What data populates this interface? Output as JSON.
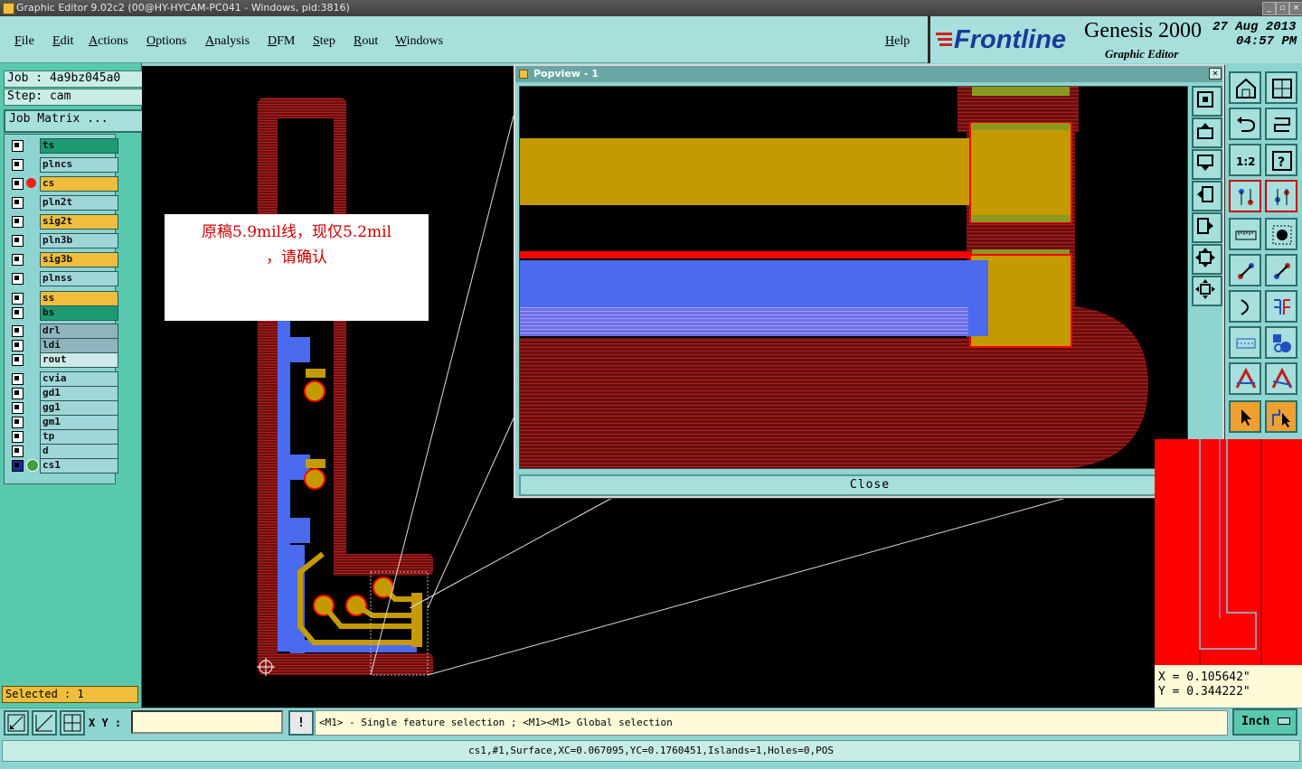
{
  "window": {
    "title": "Graphic Editor 9.02c2 (00@HY-HYCAM-PC041 - Windows, pid:3816)"
  },
  "menu": {
    "items": [
      "File",
      "Edit",
      "Actions",
      "Options",
      "Analysis",
      "DFM",
      "Step",
      "Rout",
      "Windows"
    ],
    "help": "Help"
  },
  "brand": {
    "logo": "Frontline",
    "product": "Genesis 2000",
    "subtitle": "Graphic Editor",
    "date": "27 Aug 2013",
    "time": "04:57 PM"
  },
  "job": {
    "job_label": "Job : 4a9bz045a0",
    "step_label": "Step: cam",
    "matrix_button": "Job Matrix ..."
  },
  "layers": [
    {
      "name": "ts",
      "color": "#1d9a72"
    },
    {
      "name": "plncs",
      "color": "#9fd6d8"
    },
    {
      "name": "cs",
      "color": "#f0be3c"
    },
    {
      "name": "pln2t",
      "color": "#9fd6d8"
    },
    {
      "name": "sig2t",
      "color": "#f0be3c"
    },
    {
      "name": "pln3b",
      "color": "#9fd6d8"
    },
    {
      "name": "sig3b",
      "color": "#f0be3c"
    },
    {
      "name": "plnss",
      "color": "#9fd6d8"
    },
    {
      "name": "ss",
      "color": "#f0be3c"
    },
    {
      "name": "bs",
      "color": "#1d9a72"
    },
    {
      "name": "drl",
      "color": "#8fb4bc"
    },
    {
      "name": "ldi",
      "color": "#8fb4bc"
    },
    {
      "name": "rout",
      "color": "#cfe8e8"
    },
    {
      "name": "cvia",
      "color": "#9fd6d8"
    },
    {
      "name": "gd1",
      "color": "#9fd6d8"
    },
    {
      "name": "gg1",
      "color": "#9fd6d8"
    },
    {
      "name": "gm1",
      "color": "#9fd6d8"
    },
    {
      "name": "tp",
      "color": "#9fd6d8"
    },
    {
      "name": "d",
      "color": "#9fd6d8"
    },
    {
      "name": "cs1",
      "color": "#9fd6d8"
    }
  ],
  "selected": "Selected : 1",
  "annotation": {
    "line1": "原稿5.9mil线，现仅5.2mil",
    "line2": "，请确认"
  },
  "popup": {
    "title": "Popview - 1",
    "close_label": "Close",
    "close_x": "×"
  },
  "coords": {
    "x": "X = 0.105642\"",
    "y": "Y = 0.344222\""
  },
  "bottom": {
    "xy_label": "X Y :",
    "xy_value": "",
    "hint": "<M1> - Single feature selection ; <M1><M1> Global selection",
    "units": "Inch",
    "warn": "!"
  },
  "status": "cs1,#1,Surface,XC=0.067095,YC=0.1760451,Islands=1,Holes=0,POS",
  "colors": {
    "board_red": "#8b1a1a",
    "copper_gold": "#c49a00",
    "trace_blue": "#4a6af0",
    "highlight_red": "#ff0000"
  }
}
